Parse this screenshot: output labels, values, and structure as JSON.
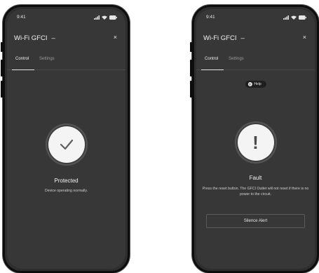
{
  "screens": [
    {
      "status_time": "9:41",
      "title": "Wi-Fi GFCI",
      "title_suffix": "–",
      "close_symbol": "×",
      "tabs": [
        {
          "label": "Control",
          "active": true
        },
        {
          "label": "Settings",
          "active": false
        }
      ],
      "status_icon": "check-icon",
      "status_title": "Protected",
      "status_description": "Device operating normally."
    },
    {
      "status_time": "9:41",
      "title": "Wi-Fi GFCI",
      "title_suffix": "–",
      "close_symbol": "×",
      "tabs": [
        {
          "label": "Control",
          "active": true
        },
        {
          "label": "Settings",
          "active": false
        }
      ],
      "help_label": "Help",
      "help_icon_glyph": "?",
      "status_icon": "exclamation-icon",
      "status_icon_glyph": "!",
      "status_title": "Fault",
      "status_description": "Press the reset button. The GFCI Outlet will not reset if there is no power to the circuit.",
      "action_button": "Silence Alert"
    }
  ],
  "colors": {
    "screen_background": "#373737",
    "bezel": "#0d0d0d",
    "text_primary": "#f2f2f2",
    "icon_circle": "#f4f4f4"
  }
}
